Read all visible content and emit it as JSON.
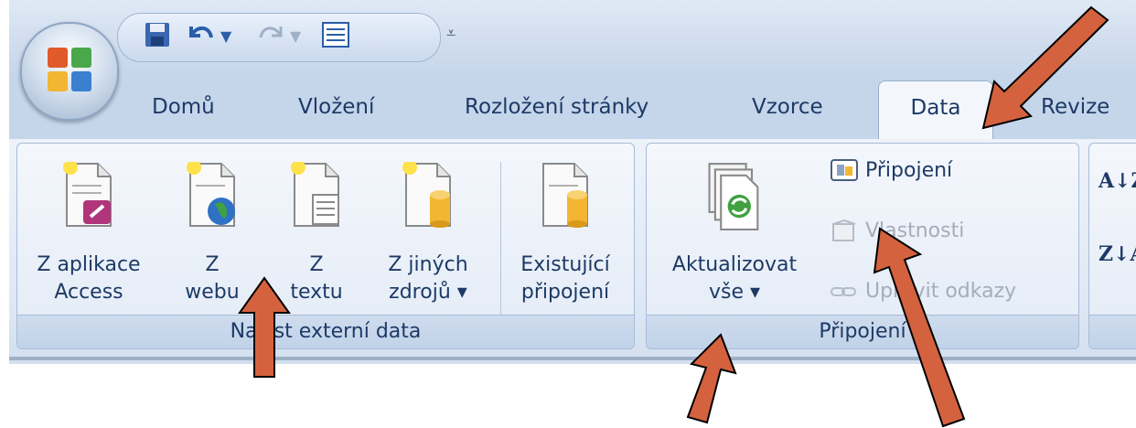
{
  "tabs": [
    {
      "label": "Domů",
      "active": false
    },
    {
      "label": "Vložení",
      "active": false
    },
    {
      "label": "Rozložení stránky",
      "active": false
    },
    {
      "label": "Vzorce",
      "active": false
    },
    {
      "label": "Data",
      "active": true
    },
    {
      "label": "Revize",
      "active": false
    }
  ],
  "groups": {
    "external_data": {
      "label": "Načíst externí data",
      "buttons": [
        {
          "line1": "Z aplikace",
          "line2": "Access",
          "icon": "access-icon"
        },
        {
          "line1": "Z",
          "line2": "webu",
          "icon": "globe-icon"
        },
        {
          "line1": "Z",
          "line2": "textu",
          "icon": "text-file-icon"
        },
        {
          "line1": "Z jiných",
          "line2": "zdrojů ▾",
          "icon": "database-icon"
        },
        {
          "line1": "Existující",
          "line2": "připojení",
          "icon": "existing-connection-icon"
        }
      ]
    },
    "connections": {
      "label": "Připojení",
      "refresh_line1": "Aktualizovat",
      "refresh_line2": "vše ▾",
      "connections_label": "Připojení",
      "properties_label": "Vlastnosti",
      "edit_links_label": "Upravit odkazy"
    },
    "sort": {
      "az_label": "A↓Z",
      "za_label": "Z↓A"
    }
  },
  "colors": {
    "ribbon_text": "#1d3a66",
    "tab_bar": "#c5d5ea",
    "arrow": "#d4623f",
    "disabled_text": "#a4adb9"
  }
}
